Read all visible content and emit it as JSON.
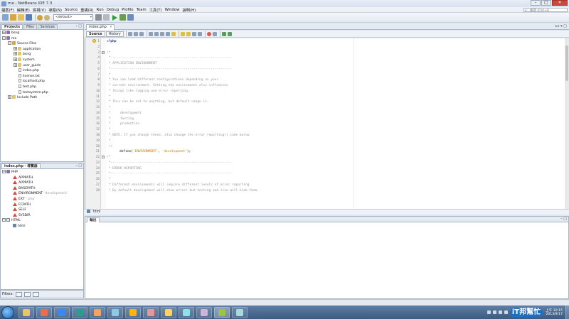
{
  "window": {
    "title": "me - NetBeans IDE 7.3"
  },
  "menu": {
    "items": [
      "檔案(F)",
      "編輯(E)",
      "檢視(V)",
      "導覽(N)",
      "Source",
      "重構(R)",
      "Run",
      "Debug",
      "Profile",
      "Team",
      "工具(T)",
      "Window",
      "說明(H)"
    ],
    "search_placeholder": "搜尋 (Ctrl+I)"
  },
  "toolbar": {
    "config": "<default>"
  },
  "projects_panel": {
    "tabs": [
      "Projects",
      "Files",
      "Services"
    ],
    "tree": [
      {
        "label": "bsng",
        "level": 0,
        "icon": "php",
        "expander": "+"
      },
      {
        "label": "me",
        "level": 0,
        "icon": "php",
        "expander": "−"
      },
      {
        "label": "Source Files",
        "level": 1,
        "icon": "src",
        "expander": "−"
      },
      {
        "label": "application",
        "level": 2,
        "icon": "folder",
        "expander": "+"
      },
      {
        "label": "bsng",
        "level": 2,
        "icon": "folder",
        "expander": "+"
      },
      {
        "label": "system",
        "level": 2,
        "icon": "folder",
        "expander": "+"
      },
      {
        "label": "user_guide",
        "level": 2,
        "icon": "folder",
        "expander": "+"
      },
      {
        "label": "index.php",
        "level": 2,
        "icon": "file",
        "expander": ""
      },
      {
        "label": "license.txt",
        "level": 2,
        "icon": "file",
        "expander": ""
      },
      {
        "label": "localhost.php",
        "level": 2,
        "icon": "file",
        "expander": ""
      },
      {
        "label": "test.php",
        "level": 2,
        "icon": "file",
        "expander": ""
      },
      {
        "label": "testsystem.php",
        "level": 2,
        "icon": "file",
        "expander": ""
      },
      {
        "label": "Include Path",
        "level": 1,
        "icon": "folder",
        "expander": "+"
      }
    ]
  },
  "navigator_panel": {
    "title": "index.php - 導覽器",
    "tree": [
      {
        "label": "PHP",
        "level": 0,
        "icon": "php",
        "expander": "−",
        "extra": ""
      },
      {
        "label": "APPPATH",
        "level": 1,
        "icon": "const",
        "expander": "",
        "extra": ""
      },
      {
        "label": "APPPATH",
        "level": 1,
        "icon": "const",
        "expander": "",
        "extra": ""
      },
      {
        "label": "BASEPATH",
        "level": 1,
        "icon": "const",
        "expander": "",
        "extra": ""
      },
      {
        "label": "ENVIRONMENT",
        "level": 1,
        "icon": "const",
        "expander": "",
        "extra": "'development'"
      },
      {
        "label": "EXT",
        "level": 1,
        "icon": "const",
        "expander": "",
        "extra": "'.php'"
      },
      {
        "label": "FCPATH",
        "level": 1,
        "icon": "const",
        "expander": "",
        "extra": ""
      },
      {
        "label": "SELF",
        "level": 1,
        "icon": "const",
        "expander": "",
        "extra": ""
      },
      {
        "label": "SYSDIR",
        "level": 1,
        "icon": "const",
        "expander": "",
        "extra": ""
      },
      {
        "label": "HTML",
        "level": 0,
        "icon": "html",
        "expander": "−",
        "extra": ""
      },
      {
        "label": "html",
        "level": 1,
        "icon": "tag",
        "expander": "",
        "extra": ""
      }
    ],
    "filter_label": "Filters:"
  },
  "editor": {
    "tab_label": "index.php",
    "source_tab": "Source",
    "history_tab": "History",
    "lines": [
      {
        "n": "1",
        "code": "<?php",
        "kw": true,
        "fold": ""
      },
      {
        "n": "2",
        "code": "",
        "fold": ""
      },
      {
        "n": "3",
        "code": "/*",
        "fold": "−"
      },
      {
        "n": "4",
        "code": " *---------------------------------------------------------------",
        "fold": ""
      },
      {
        "n": "5",
        "code": " * APPLICATION ENVIRONMENT",
        "fold": ""
      },
      {
        "n": "6",
        "code": " *---------------------------------------------------------------",
        "fold": ""
      },
      {
        "n": "7",
        "code": " *",
        "fold": ""
      },
      {
        "n": "8",
        "code": " * You can load different configurations depending on your",
        "fold": ""
      },
      {
        "n": "9",
        "code": " * current environment. Setting the environment also influences",
        "fold": ""
      },
      {
        "n": "10",
        "code": " * things like logging and error reporting.",
        "fold": ""
      },
      {
        "n": "11",
        "code": " *",
        "fold": ""
      },
      {
        "n": "12",
        "code": " * This can be set to anything, but default usage is:",
        "fold": ""
      },
      {
        "n": "13",
        "code": " *",
        "fold": ""
      },
      {
        "n": "14",
        "code": " *     development",
        "fold": ""
      },
      {
        "n": "15",
        "code": " *     testing",
        "fold": ""
      },
      {
        "n": "16",
        "code": " *     production",
        "fold": ""
      },
      {
        "n": "17",
        "code": " *",
        "fold": ""
      },
      {
        "n": "18",
        "code": " * NOTE: If you change these, also change the error_reporting() code below",
        "fold": ""
      },
      {
        "n": "19",
        "code": " *",
        "fold": ""
      },
      {
        "n": "20",
        "code": " */",
        "fold": ""
      },
      {
        "n": "21",
        "code": "",
        "define": true,
        "fold": ""
      },
      {
        "n": "22",
        "code": "/*",
        "fold": "−"
      },
      {
        "n": "23",
        "code": " *---------------------------------------------------------------",
        "fold": ""
      },
      {
        "n": "24",
        "code": " * ERROR REPORTING",
        "fold": ""
      },
      {
        "n": "25",
        "code": " *---------------------------------------------------------------",
        "fold": ""
      },
      {
        "n": "26",
        "code": " *",
        "fold": ""
      },
      {
        "n": "27",
        "code": " * Different environments will require different levels of error reporting.",
        "fold": ""
      },
      {
        "n": "28",
        "code": " * By default development will show errors but testing and live will hide them.",
        "fold": ""
      }
    ],
    "define_parts": {
      "fn": "define(",
      "arg1": "'ENVIRONMENT'",
      "comma": ", ",
      "arg2": "'development'",
      "end": ");"
    }
  },
  "breadcrumb": {
    "label": "html"
  },
  "output": {
    "tab_label": "輸出"
  },
  "taskbar": {
    "clock_time": "上午 10:15",
    "clock_date": "2013/9/17",
    "brand": "iT邦幫忙",
    "apps": [
      {
        "name": "file-explorer",
        "color": "#e9c46a"
      },
      {
        "name": "media-player",
        "color": "#e76f51"
      },
      {
        "name": "internet-explorer",
        "color": "#3a86ff"
      },
      {
        "name": "chrome",
        "color": "#2a9d8f"
      },
      {
        "name": "firefox",
        "color": "#f4a261"
      },
      {
        "name": "remote-desktop",
        "color": "#8ecae6"
      },
      {
        "name": "paint",
        "color": "#ffb703"
      },
      {
        "name": "qq",
        "color": "#e5989b"
      },
      {
        "name": "messenger",
        "color": "#ffd166"
      },
      {
        "name": "flight",
        "color": "#90e0ef"
      },
      {
        "name": "terminal",
        "color": "#cdb4db"
      },
      {
        "name": "netbeans",
        "color": "#9bc53d"
      },
      {
        "name": "virtualbox",
        "color": "#a8dadc"
      }
    ]
  }
}
